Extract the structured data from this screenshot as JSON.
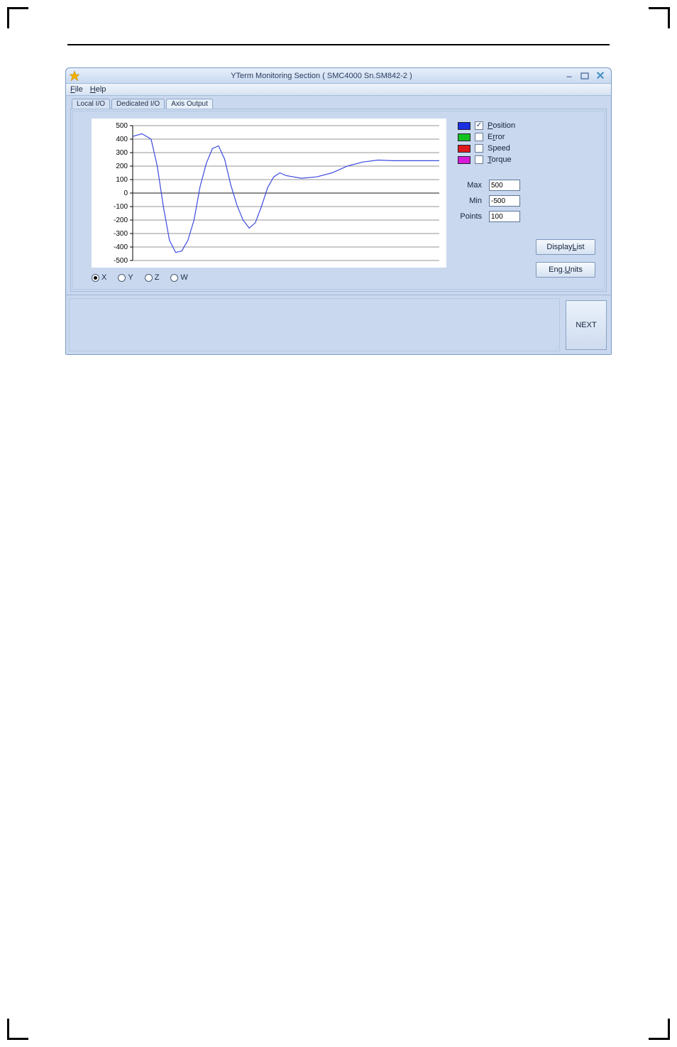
{
  "window": {
    "title": "YTerm Monitoring Section ( SMC4000 Sn.SM842-2 )"
  },
  "menu": {
    "file": "File",
    "help": "Help"
  },
  "tabs": {
    "local_io": "Local I/O",
    "dedicated_io": "Dedicated I/O",
    "axis_output": "Axis Output",
    "active_index": 2
  },
  "axes_radio": {
    "items": [
      "X",
      "Y",
      "Z",
      "W"
    ],
    "selected": "X"
  },
  "legend": {
    "position": {
      "label": "Position",
      "checked": true,
      "color": "blue"
    },
    "error": {
      "label": "Error",
      "checked": false,
      "color": "green"
    },
    "speed": {
      "label": "Speed",
      "checked": false,
      "color": "red"
    },
    "torque": {
      "label": "Torque",
      "checked": false,
      "color": "magenta"
    }
  },
  "fields": {
    "max_label": "Max",
    "max_value": "500",
    "min_label": "Min",
    "min_value": "-500",
    "points_label": "Points",
    "points_value": "100"
  },
  "buttons": {
    "display_list": "Display List",
    "eng_units": "Eng. Units",
    "next": "NEXT"
  },
  "chart_data": {
    "type": "line",
    "ylim": [
      -500,
      500
    ],
    "yticks": [
      500,
      400,
      300,
      200,
      100,
      0,
      -100,
      -200,
      -300,
      -400,
      -500
    ],
    "series": [
      {
        "name": "Position",
        "color": "#3b4be0",
        "x": [
          0,
          3,
          6,
          8,
          10,
          12,
          14,
          16,
          18,
          20,
          22,
          24,
          26,
          28,
          30,
          32,
          34,
          36,
          38,
          40,
          42,
          44,
          46,
          48,
          50,
          55,
          60,
          65,
          70,
          75,
          80,
          85,
          90,
          95,
          100
        ],
        "y": [
          420,
          440,
          400,
          200,
          -100,
          -350,
          -440,
          -430,
          -350,
          -200,
          50,
          220,
          330,
          350,
          250,
          60,
          -90,
          -200,
          -260,
          -220,
          -100,
          40,
          120,
          150,
          130,
          110,
          120,
          150,
          200,
          230,
          245,
          240,
          240,
          240,
          240
        ]
      }
    ]
  }
}
